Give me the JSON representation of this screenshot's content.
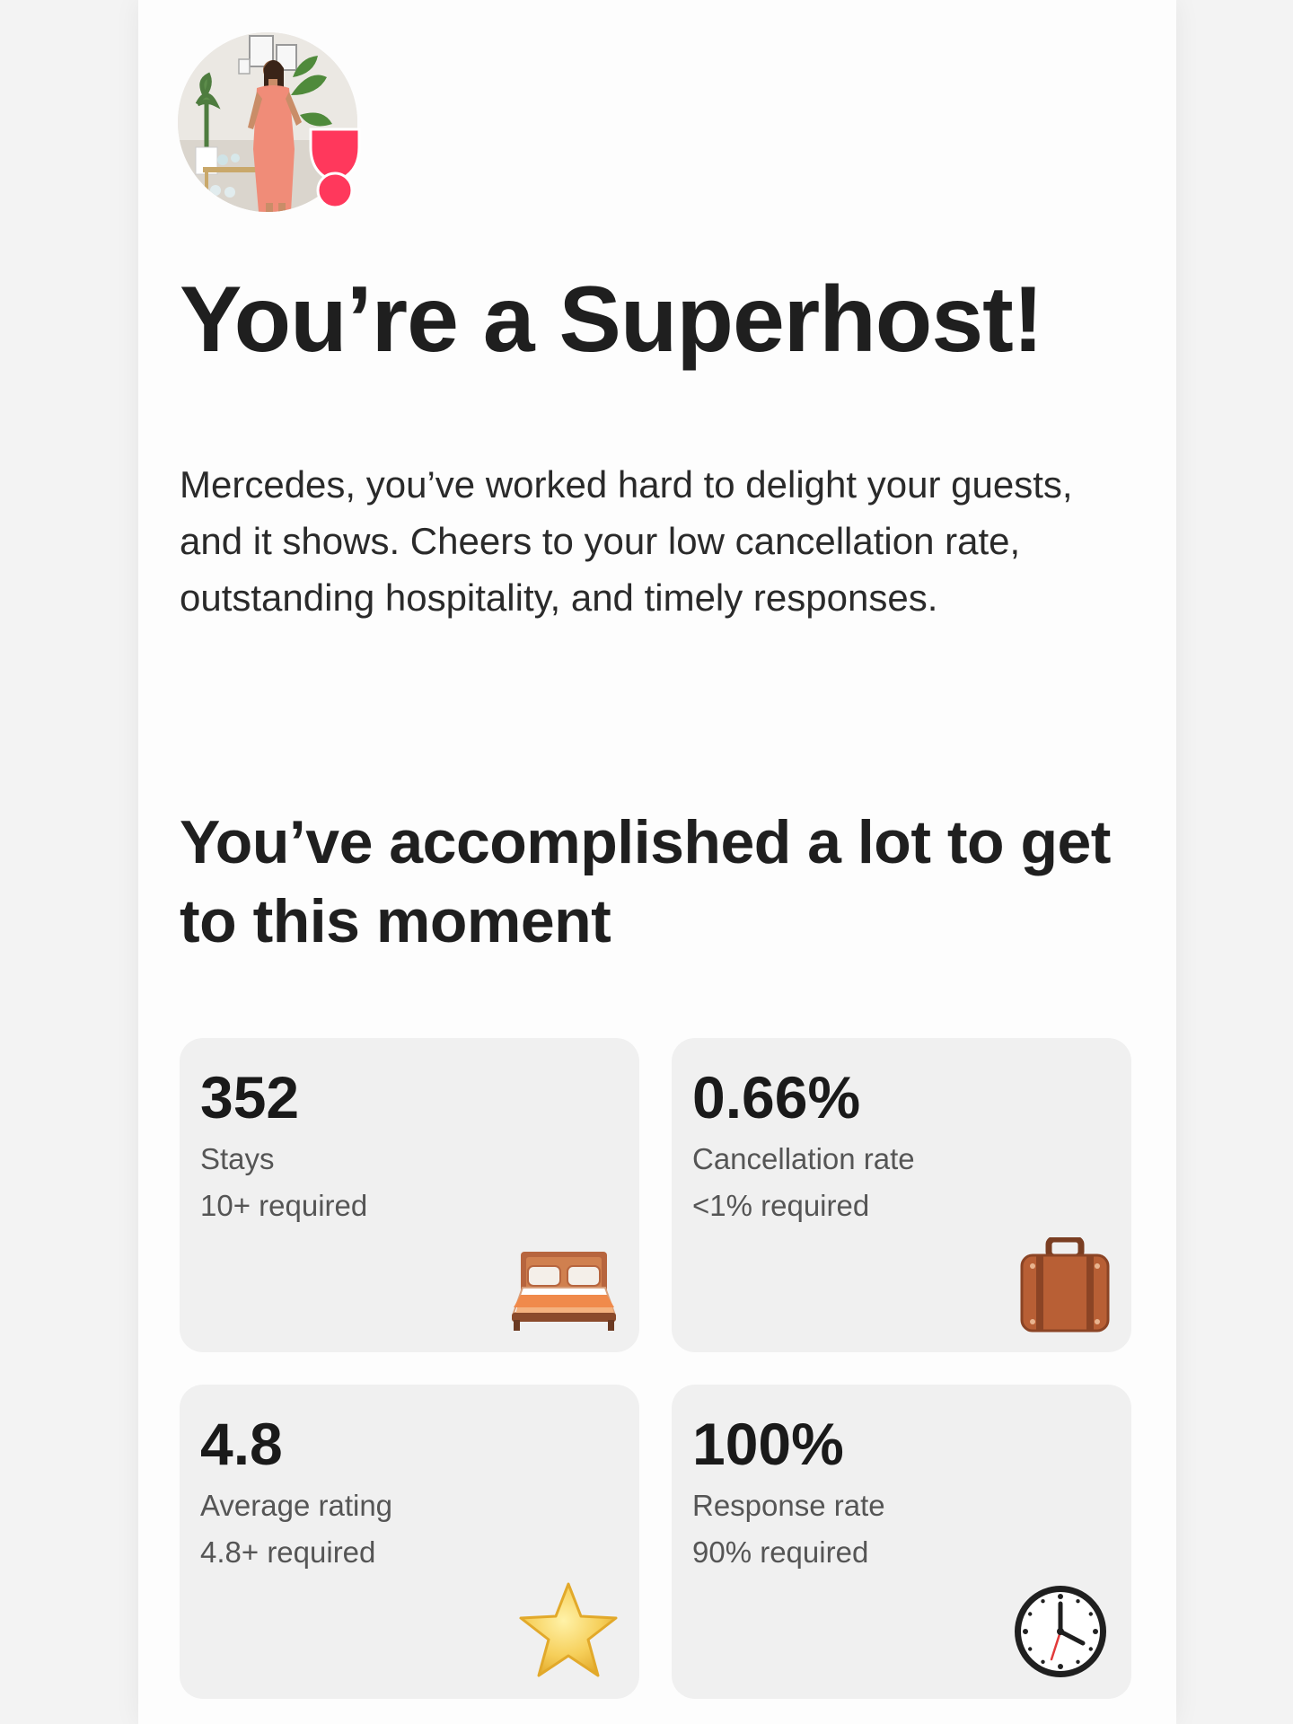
{
  "header": {
    "title": "You’re a Superhost!",
    "intro": "Mercedes, you’ve worked hard to delight your guests, and it shows. Cheers to your low cancellation rate, outstanding hospitality, and timely responses."
  },
  "section": {
    "title": "You’ve accomplished a lot to get to this moment"
  },
  "stats": [
    {
      "value": "352",
      "label": "Stays",
      "requirement": "10+ required",
      "icon": "bed-icon"
    },
    {
      "value": "0.66%",
      "label": "Cancellation rate",
      "requirement": "<1% required",
      "icon": "suitcase-icon"
    },
    {
      "value": "4.8",
      "label": "Average rating",
      "requirement": "4.8+ required",
      "icon": "star-icon"
    },
    {
      "value": "100%",
      "label": "Response rate",
      "requirement": "90% required",
      "icon": "clock-icon"
    }
  ],
  "colors": {
    "brand": "#ff385c",
    "card_background": "#f0f0f0",
    "text_primary": "#222222",
    "text_secondary": "#555555"
  }
}
